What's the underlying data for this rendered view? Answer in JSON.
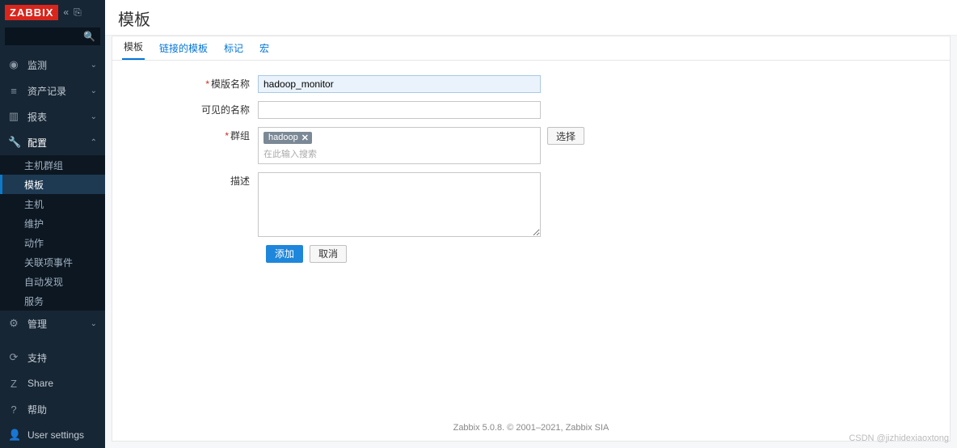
{
  "logo": "ZABBIX",
  "page_title": "模板",
  "search": {
    "placeholder": ""
  },
  "nav": {
    "sections": [
      {
        "icon": "◉",
        "label": "监测"
      },
      {
        "icon": "≡",
        "label": "资产记录"
      },
      {
        "icon": "▥",
        "label": "报表"
      },
      {
        "icon": "🔧",
        "label": "配置",
        "expanded": true
      },
      {
        "icon": "⚙",
        "label": "管理"
      }
    ],
    "config_sub": [
      "主机群组",
      "模板",
      "主机",
      "维护",
      "动作",
      "关联项事件",
      "自动发现",
      "服务"
    ],
    "bottom": [
      {
        "icon": "⟳",
        "label": "支持"
      },
      {
        "icon": "Z",
        "label": "Share"
      },
      {
        "icon": "?",
        "label": "帮助"
      },
      {
        "icon": "👤",
        "label": "User settings"
      }
    ]
  },
  "tabs": [
    "模板",
    "链接的模板",
    "标记",
    "宏"
  ],
  "form": {
    "template_name_label": "模版名称",
    "template_name_value": "hadoop_monitor",
    "visible_name_label": "可见的名称",
    "visible_name_value": "",
    "group_label": "群组",
    "group_tag": "hadoop",
    "group_placeholder": "在此输入搜索",
    "select_btn": "选择",
    "desc_label": "描述",
    "desc_value": "",
    "add_btn": "添加",
    "cancel_btn": "取消"
  },
  "footer": "Zabbix 5.0.8. © 2001–2021, Zabbix SIA",
  "watermark": "CSDN @jizhidexiaoxtong"
}
